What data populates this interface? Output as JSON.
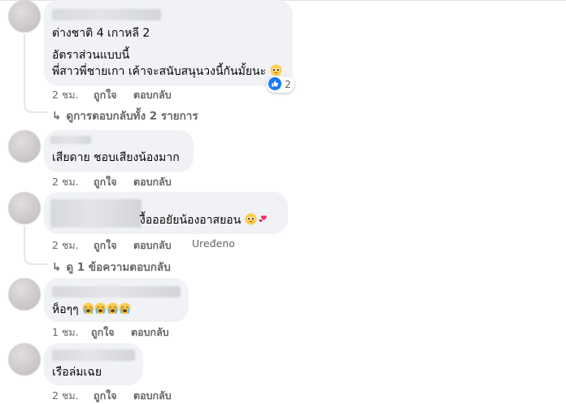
{
  "comments": [
    {
      "line1": "ต่างชาติ 4 เกาหลี 2",
      "line2": "อัตราส่วนแบบนี้",
      "line3": "พี่สาวพี่ชายเกา เค้าจะสนับสนุนวงนี้กันมั้ยนะ",
      "time": "2 ชม.",
      "like": "ถูกใจ",
      "reply": "ตอบกลับ",
      "reaction_count": "2",
      "replies_link": "ดูการตอบกลับทั้ง 2 รายการ"
    },
    {
      "text": "เสียดาย ชอบเสียงน้องมาก",
      "time": "2 ชม.",
      "like": "ถูกใจ",
      "reply": "ตอบกลับ"
    },
    {
      "text": "งื้อออยัยน้องอาสยอน",
      "time": "2 ชม.",
      "like": "ถูกใจ",
      "reply": "ตอบกลับ",
      "edited": "Uređeno",
      "replies_link": "ดู 1 ข้อความตอบกลับ"
    },
    {
      "text": "ห็อๆๆ",
      "time": "1 ชม.",
      "like": "ถูกใจ",
      "reply": "ตอบกลับ"
    },
    {
      "text": "เรือล่มเฉย",
      "time": "2 ชม.",
      "like": "ถูกใจ",
      "reply": "ตอบกลับ"
    }
  ],
  "colors": {
    "bubble": "#f0f2f5",
    "meta": "#65676b",
    "like_blue": "#1877f2"
  },
  "icons": [
    "pleading-face-emoji",
    "hearts-emoji",
    "crying-face-emoji",
    "like-thumb-icon",
    "reply-arrow-icon"
  ]
}
